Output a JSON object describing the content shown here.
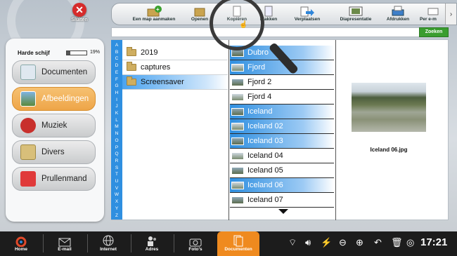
{
  "close": {
    "label": "Sluiten"
  },
  "toolbar": {
    "buttons": [
      "Een map aanmaken",
      "Openen",
      "Kopiëren",
      "Plakken",
      "Verplaatsen",
      "Diapresentatie",
      "Afdrukken",
      "Per e-m"
    ]
  },
  "search": {
    "button": "Zoeken",
    "value": ""
  },
  "disk": {
    "label": "Harde schijf",
    "percent": "19%",
    "fill": 0.19
  },
  "nav": {
    "items": [
      "Documenten",
      "Afbeeldingen",
      "Muziek",
      "Divers",
      "Prullenmand"
    ],
    "active": "Afbeeldingen"
  },
  "alphabet": [
    "A",
    "B",
    "C",
    "D",
    "E",
    "F",
    "G",
    "H",
    "I",
    "J",
    "K",
    "L",
    "M",
    "N",
    "O",
    "P",
    "Q",
    "R",
    "S",
    "T",
    "U",
    "V",
    "W",
    "X",
    "Y",
    "Z"
  ],
  "folders": [
    {
      "name": "2019",
      "selected": false
    },
    {
      "name": "captures",
      "selected": false
    },
    {
      "name": "Screensaver",
      "selected": true
    }
  ],
  "files": [
    {
      "name": "Dubro",
      "selected": true
    },
    {
      "name": "Fjord",
      "selected": true
    },
    {
      "name": "Fjord 2",
      "selected": false
    },
    {
      "name": "Fjord 4",
      "selected": false
    },
    {
      "name": "Iceland",
      "selected": true
    },
    {
      "name": "Iceland 02",
      "selected": true
    },
    {
      "name": "Iceland 03",
      "selected": true
    },
    {
      "name": "Iceland 04",
      "selected": false
    },
    {
      "name": "Iceland 05",
      "selected": false
    },
    {
      "name": "Iceland 06",
      "selected": true
    },
    {
      "name": "Iceland 07",
      "selected": false
    }
  ],
  "preview": {
    "caption": "Iceland 06.jpg"
  },
  "taskbar": {
    "items": [
      "Home",
      "E-mail",
      "Internet",
      "Adres",
      "Foto's",
      "Documenten"
    ],
    "active": "Documenten",
    "clock": "17:21"
  }
}
